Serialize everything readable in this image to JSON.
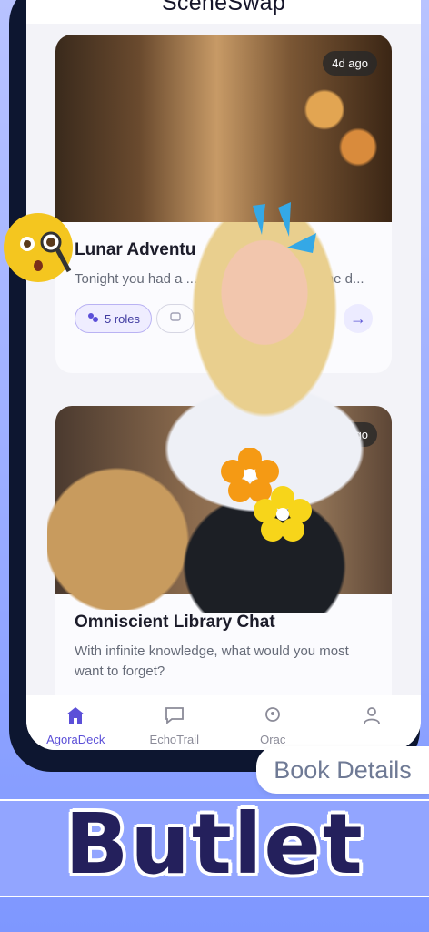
{
  "app": {
    "title": "SceneSwap"
  },
  "cards": [
    {
      "time": "4d ago",
      "title": "Lunar Adventu",
      "desc": "Tonight you had a ... n, what were you in the d...",
      "roles": "5 roles"
    },
    {
      "time": "5d ago",
      "title": "Omniscient Library Chat",
      "desc": "With infinite knowledge, what would you most want to forget?"
    }
  ],
  "nav": {
    "items": [
      {
        "label": "AgoraDeck",
        "icon": "home-icon",
        "active": true
      },
      {
        "label": "EchoTrail",
        "icon": "chat-icon",
        "active": false
      },
      {
        "label": "Orac",
        "icon": "oracle-head-icon",
        "active": false
      },
      {
        "label": "",
        "icon": "profile-icon",
        "active": false
      }
    ]
  },
  "promo": {
    "feature_label": "Book Details",
    "brand": "Butlet"
  },
  "colors": {
    "accent": "#5b4fd8",
    "frame": "#0d1630",
    "brand_text": "#24205c",
    "background": "#9fb0ff"
  }
}
